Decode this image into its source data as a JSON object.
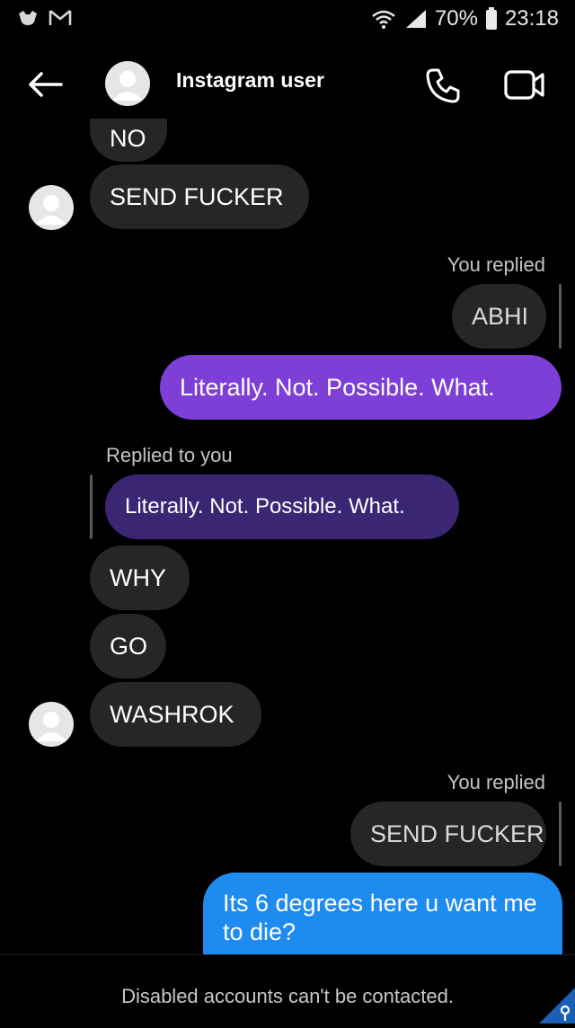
{
  "status_bar": {
    "battery": "70%",
    "time": "23:18",
    "colors": {
      "bg": "#000000",
      "text": "#e8e8e8"
    }
  },
  "header": {
    "title": "Instagram user",
    "icons": {
      "back": "arrow-left-icon",
      "call": "phone-icon",
      "video": "video-camera-icon"
    }
  },
  "messages": [
    {
      "side": "left",
      "text": "NO",
      "partial": true
    },
    {
      "side": "left",
      "text": "SEND FUCKER"
    },
    {
      "side": "right",
      "label": "You replied",
      "quote": "ABHI"
    },
    {
      "side": "right",
      "text": "Literally. Not. Possible. What."
    },
    {
      "side": "left",
      "label": "Replied to you",
      "quote": "Literally. Not. Possible. What."
    },
    {
      "side": "left",
      "text": "WHY"
    },
    {
      "side": "left",
      "text": "GO"
    },
    {
      "side": "left",
      "text": "WASHROK"
    },
    {
      "side": "right",
      "label": "You replied",
      "quote": "SEND FUCKER"
    },
    {
      "side": "right",
      "text": "Its 6 degrees here u want me to die?"
    }
  ],
  "footer": {
    "notice": "Disabled accounts can't be contacted."
  },
  "colors": {
    "incoming": "#262626",
    "outgoing_purple": "#7d3fd6",
    "quoted_purple": "#3a2673",
    "outgoing_blue": "#1e8bf0"
  }
}
